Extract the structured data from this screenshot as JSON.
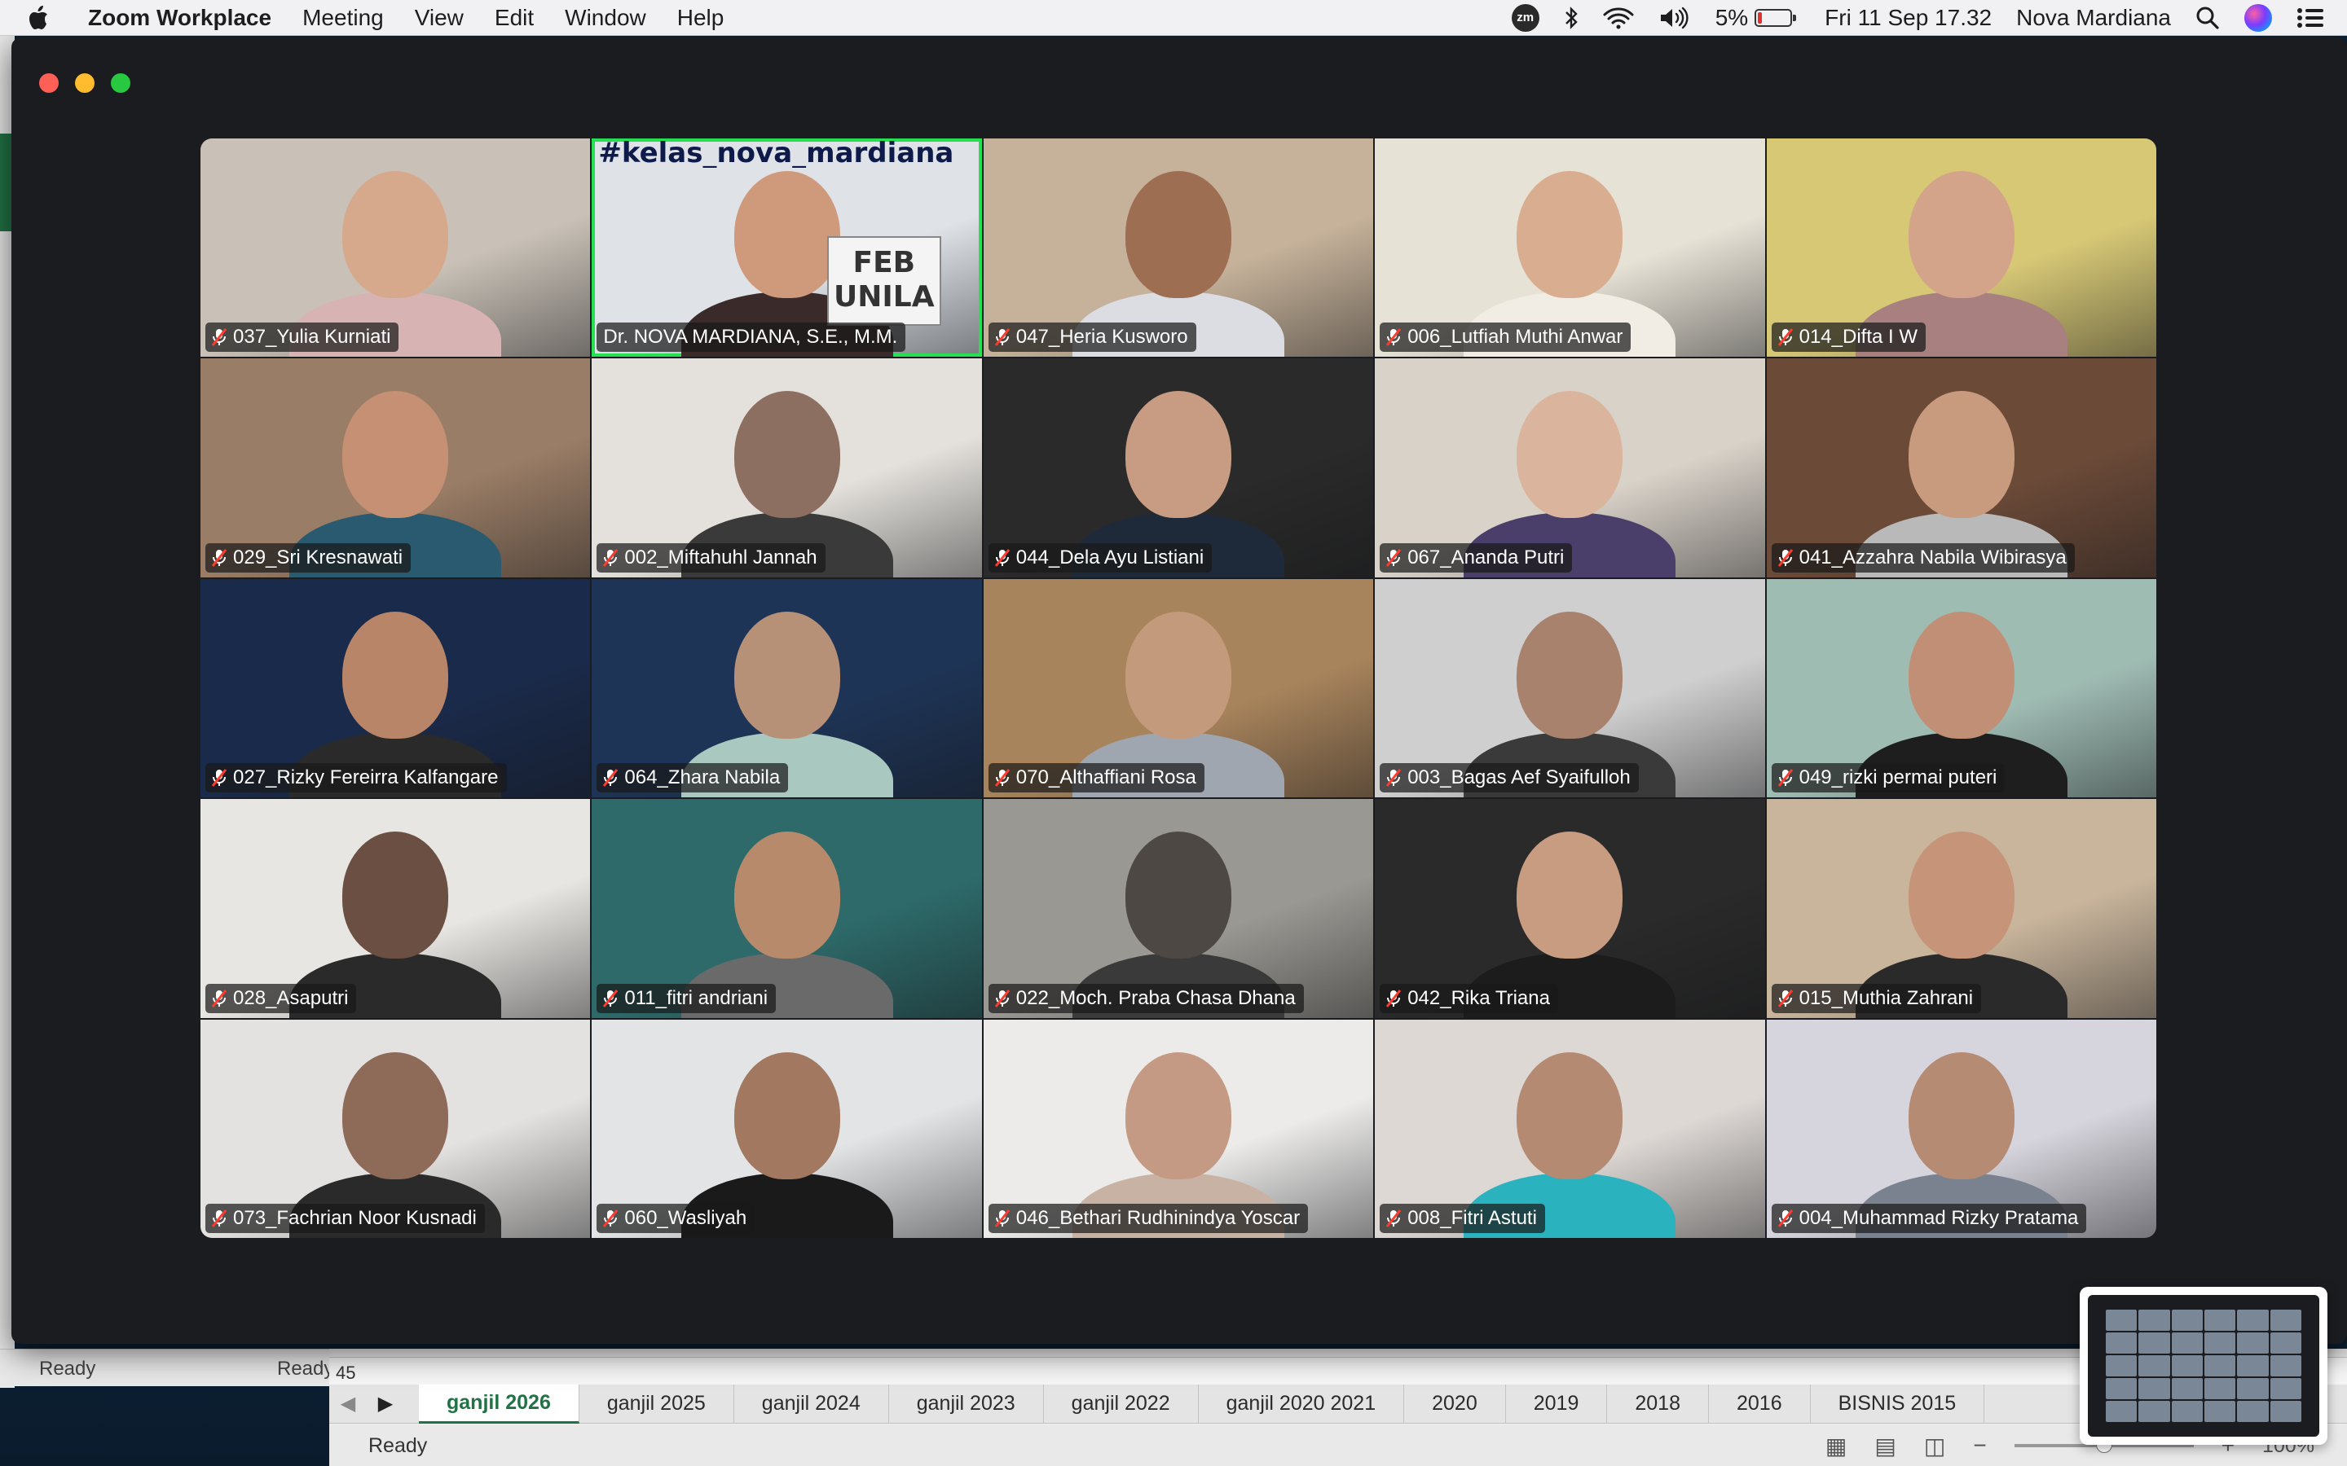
{
  "menubar": {
    "app_name": "Zoom Workplace",
    "menus": [
      "Meeting",
      "View",
      "Edit",
      "Window",
      "Help"
    ],
    "status": {
      "zoom_badge": "zm",
      "battery_percent": "5%",
      "datetime": "Fri 11 Sep  17.32",
      "user": "Nova Mardiana"
    }
  },
  "meeting": {
    "host_banner": "#kelas_nova_mardiana",
    "host_sign": "FEB UNILA",
    "participants": [
      {
        "name": "037_Yulia Kurniati",
        "muted": true,
        "bg": "#c9c1b7",
        "skin": "#d7a98c",
        "cloth": "#d8b3b4"
      },
      {
        "name": "Dr. NOVA MARDIANA, S.E., M.M.",
        "muted": false,
        "bg": "#dfe3e8",
        "skin": "#cf9a7c",
        "cloth": "#3a2a2a",
        "host": true
      },
      {
        "name": "047_Heria Kusworo",
        "muted": true,
        "bg": "#c6b29a",
        "skin": "#9e6e52",
        "cloth": "#dcdde3"
      },
      {
        "name": "006_Lutfiah Muthi Anwar",
        "muted": true,
        "bg": "#e7e2d6",
        "skin": "#d8ad90",
        "cloth": "#f1ece4"
      },
      {
        "name": "014_Difta I W",
        "muted": true,
        "bg": "#d7c876",
        "skin": "#d4a48a",
        "cloth": "#a88080"
      },
      {
        "name": "029_Sri Kresnawati",
        "muted": true,
        "bg": "#9a7d66",
        "skin": "#c69074",
        "cloth": "#2a5a70"
      },
      {
        "name": "002_Miftahuhl Jannah",
        "muted": true,
        "bg": "#e4e1dc",
        "skin": "#8d6f62",
        "cloth": "#3a3a3a"
      },
      {
        "name": "044_Dela Ayu Listiani",
        "muted": true,
        "bg": "#2a2a2a",
        "skin": "#c79c82",
        "cloth": "#1e2a3a"
      },
      {
        "name": "067_Ananda Putri",
        "muted": true,
        "bg": "#d9d2c9",
        "skin": "#dab49c",
        "cloth": "#4a3f6a"
      },
      {
        "name": "041_Azzahra Nabila Wibirasya",
        "muted": true,
        "bg": "#6b4a38",
        "skin": "#c89a7e",
        "cloth": "#b9b9b9"
      },
      {
        "name": "027_Rizky Fereirra Kalfangare",
        "muted": true,
        "bg": "#1a2a4a",
        "skin": "#b98568",
        "cloth": "#2a2a2a"
      },
      {
        "name": "064_Zhara Nabila",
        "muted": true,
        "bg": "#1e3456",
        "skin": "#b79078",
        "cloth": "#a9c9c0"
      },
      {
        "name": "070_Althaffiani Rosa",
        "muted": true,
        "bg": "#a8845c",
        "skin": "#c49a7c",
        "cloth": "#a0a6b0"
      },
      {
        "name": "003_Bagas Aef Syaifulloh",
        "muted": true,
        "bg": "#cfcfcf",
        "skin": "#a8826c",
        "cloth": "#3a3a3a"
      },
      {
        "name": "049_rizki permai puteri",
        "muted": true,
        "bg": "#9fbcb3",
        "skin": "#c08f76",
        "cloth": "#1e1e1e"
      },
      {
        "name": "028_Asaputri",
        "muted": true,
        "bg": "#e8e6e2",
        "skin": "#6b4f42",
        "cloth": "#2a2a2a"
      },
      {
        "name": "011_fitri andriani",
        "muted": true,
        "bg": "#2e6a6a",
        "skin": "#b88a6c",
        "cloth": "#6a6a6a"
      },
      {
        "name": "022_Moch. Praba Chasa Dhana",
        "muted": true,
        "bg": "#9a9892",
        "skin": "#4e4844",
        "cloth": "#3a3a3a"
      },
      {
        "name": "042_Rika Triana",
        "muted": true,
        "bg": "#2a2a2a",
        "skin": "#c79c80",
        "cloth": "#1c1c1c"
      },
      {
        "name": "015_Muthia Zahrani",
        "muted": true,
        "bg": "#c9b59c",
        "skin": "#c69478",
        "cloth": "#2a2a2a"
      },
      {
        "name": "073_Fachrian Noor Kusnadi",
        "muted": true,
        "bg": "#e4e2e0",
        "skin": "#8e6a58",
        "cloth": "#2a2a2a"
      },
      {
        "name": "060_Wasliyah",
        "muted": true,
        "bg": "#e2e4e6",
        "skin": "#a27860",
        "cloth": "#1a1a1a"
      },
      {
        "name": "046_Bethari Rudhinindya Yoscar",
        "muted": true,
        "bg": "#ecebea",
        "skin": "#c49a84",
        "cloth": "#c8b2a4"
      },
      {
        "name": "008_Fitri Astuti",
        "muted": true,
        "bg": "#ddd8d4",
        "skin": "#b48a72",
        "cloth": "#2ab3bf"
      },
      {
        "name": "004_Muhammad Rizky Pratama",
        "muted": true,
        "bg": "#d6d4dc",
        "skin": "#b58b74",
        "cloth": "#7a8290"
      }
    ]
  },
  "excel": {
    "status_left": "Ready",
    "status_left_2": "Ready",
    "cell_value": "45",
    "sheets": [
      "ganjil 2026",
      "ganjil 2025",
      "ganjil 2024",
      "ganjil 2023",
      "ganjil 2022",
      "ganjil 2020 2021",
      "2020",
      "2019",
      "2018",
      "2016",
      "BISNIS 2015"
    ],
    "active_sheet": "ganjil 2026",
    "status": "Ready",
    "zoom": "100%"
  },
  "colors": {
    "active_speaker": "#24e052",
    "excel_green": "#217346"
  }
}
